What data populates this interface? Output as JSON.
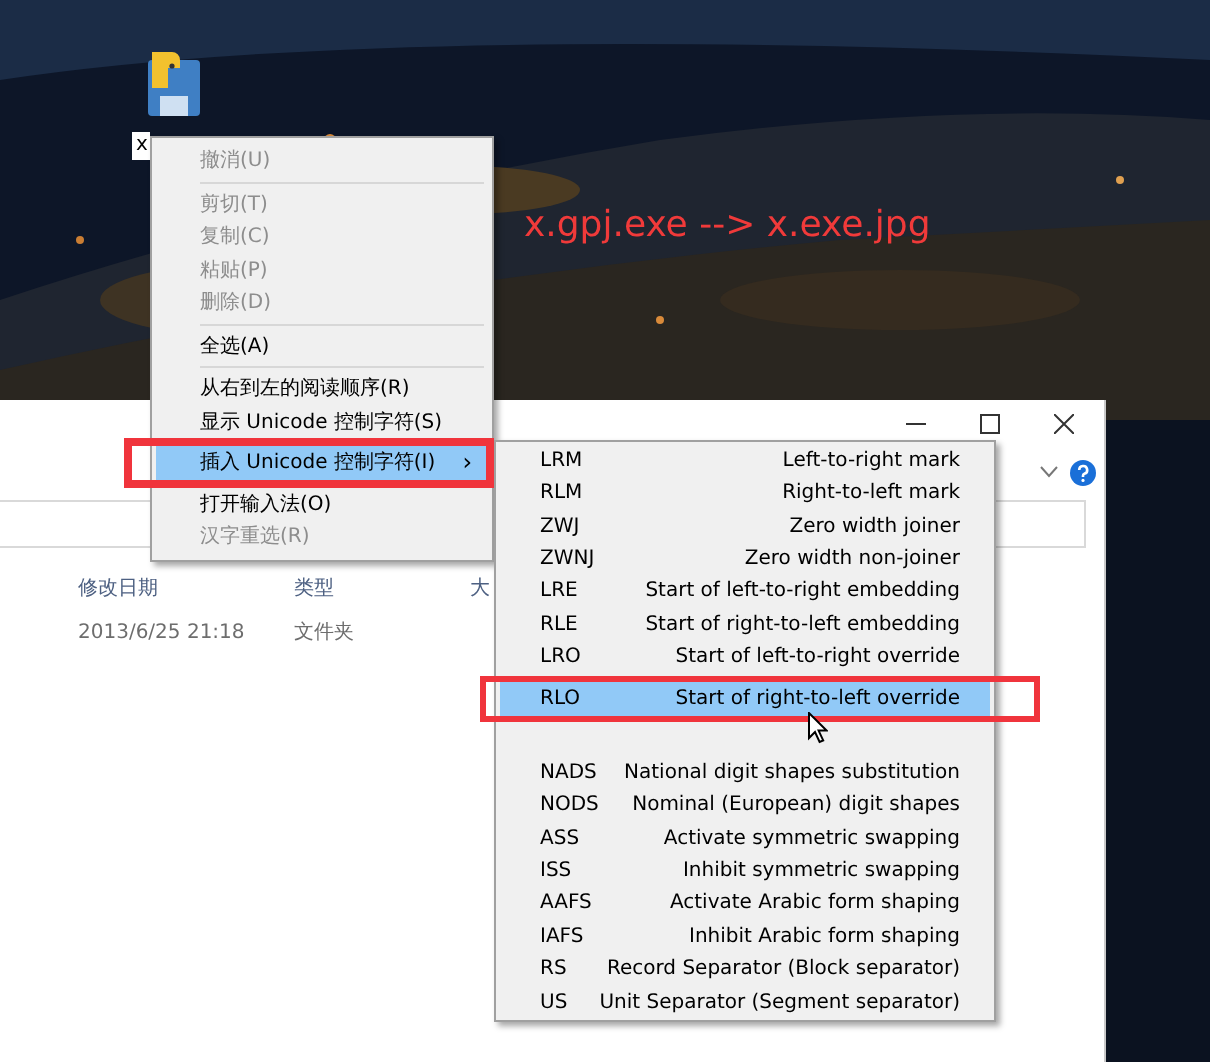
{
  "desktop": {
    "icon_label": "x",
    "annotation": "x.gpj.exe --> x.exe.jpg"
  },
  "explorer": {
    "columns": [
      "修改日期",
      "类型",
      "大"
    ],
    "rows": [
      [
        "2013/6/25 21:18",
        "文件夹"
      ]
    ]
  },
  "context_menu": {
    "items": [
      {
        "kind": "item",
        "label": "撤消(U)",
        "disabled": true,
        "selected": false
      },
      {
        "kind": "separator"
      },
      {
        "kind": "item",
        "label": "剪切(T)",
        "disabled": true,
        "selected": false
      },
      {
        "kind": "item",
        "label": "复制(C)",
        "disabled": true,
        "selected": false
      },
      {
        "kind": "item",
        "label": "粘贴(P)",
        "disabled": true,
        "selected": false
      },
      {
        "kind": "item",
        "label": "删除(D)",
        "disabled": true,
        "selected": false
      },
      {
        "kind": "separator"
      },
      {
        "kind": "item",
        "label": "全选(A)",
        "disabled": false,
        "selected": false
      },
      {
        "kind": "separator"
      },
      {
        "kind": "item",
        "label": "从右到左的阅读顺序(R)",
        "disabled": false,
        "selected": false
      },
      {
        "kind": "item",
        "label": "显示 Unicode 控制字符(S)",
        "disabled": false,
        "selected": false
      },
      {
        "kind": "item",
        "label": "插入 Unicode 控制字符(I)",
        "disabled": false,
        "selected": true,
        "arrow": "›"
      },
      {
        "kind": "item",
        "label": "打开输入法(O)",
        "disabled": false,
        "selected": false
      },
      {
        "kind": "item",
        "label": "汉字重选(R)",
        "disabled": true,
        "selected": false
      }
    ]
  },
  "submenu": {
    "items": [
      {
        "kind": "item",
        "code": "LRM",
        "label": "Left-to-right mark",
        "selected": false
      },
      {
        "kind": "item",
        "code": "RLM",
        "label": "Right-to-left mark",
        "selected": false
      },
      {
        "kind": "item",
        "code": "ZWJ",
        "label": "Zero width joiner",
        "selected": false
      },
      {
        "kind": "item",
        "code": "ZWNJ",
        "label": "Zero width non-joiner",
        "selected": false
      },
      {
        "kind": "item",
        "code": "LRE",
        "label": "Start of left-to-right embedding",
        "selected": false
      },
      {
        "kind": "item",
        "code": "RLE",
        "label": "Start of right-to-left embedding",
        "selected": false
      },
      {
        "kind": "item",
        "code": "LRO",
        "label": "Start of left-to-right override",
        "selected": false
      },
      {
        "kind": "item",
        "code": "RLO",
        "label": "Start of right-to-left override",
        "selected": true
      },
      {
        "kind": "obscured"
      },
      {
        "kind": "item",
        "code": "NADS",
        "label": "National digit shapes substitution",
        "selected": false
      },
      {
        "kind": "item",
        "code": "NODS",
        "label": "Nominal (European) digit shapes",
        "selected": false
      },
      {
        "kind": "item",
        "code": "ASS",
        "label": "Activate symmetric swapping",
        "selected": false
      },
      {
        "kind": "item",
        "code": "ISS",
        "label": "Inhibit symmetric swapping",
        "selected": false
      },
      {
        "kind": "item",
        "code": "AAFS",
        "label": "Activate Arabic form shaping",
        "selected": false
      },
      {
        "kind": "item",
        "code": "IAFS",
        "label": "Inhibit Arabic form shaping",
        "selected": false
      },
      {
        "kind": "item",
        "code": "RS",
        "label": "Record Separator (Block separator)",
        "selected": false
      },
      {
        "kind": "item",
        "code": "US",
        "label": "Unit Separator (Segment separator)",
        "selected": false
      }
    ]
  }
}
